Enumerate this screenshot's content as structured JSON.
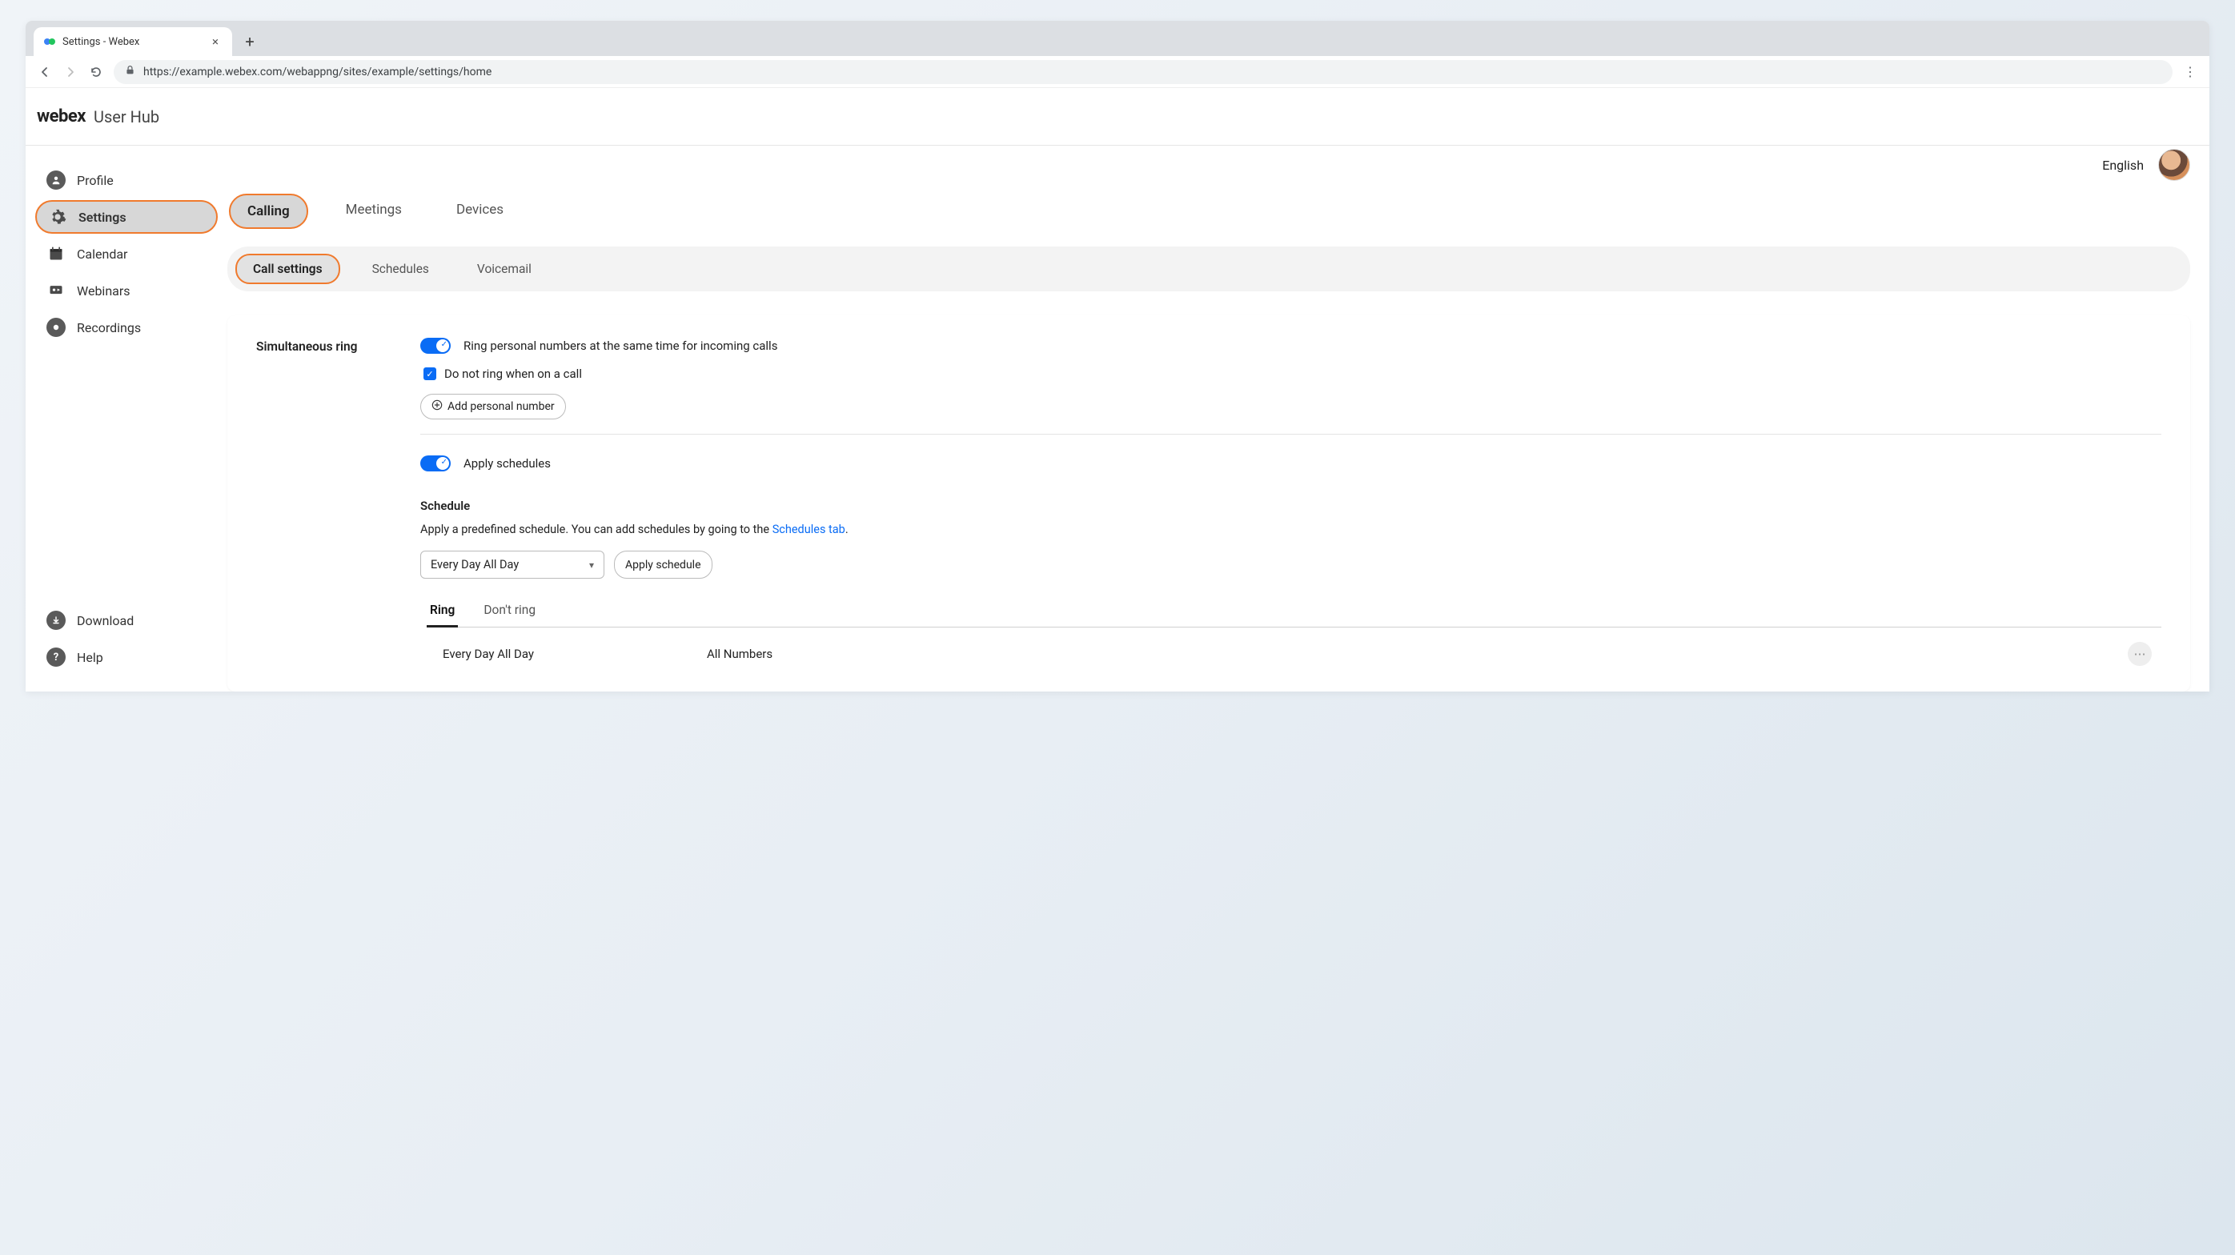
{
  "browser": {
    "tab_title": "Settings - Webex",
    "url": "https://example.webex.com/webappng/sites/example/settings/home"
  },
  "header": {
    "logo": "webex",
    "hub": "User Hub"
  },
  "topright": {
    "language": "English"
  },
  "sidebar": {
    "profile": "Profile",
    "settings": "Settings",
    "calendar": "Calendar",
    "webinars": "Webinars",
    "recordings": "Recordings",
    "download": "Download",
    "help": "Help"
  },
  "primary_tabs": {
    "calling": "Calling",
    "meetings": "Meetings",
    "devices": "Devices"
  },
  "sub_tabs": {
    "call_settings": "Call settings",
    "schedules": "Schedules",
    "voicemail": "Voicemail"
  },
  "simring": {
    "title": "Simultaneous ring",
    "toggle_label": "Ring personal numbers at the same time for incoming calls",
    "checkbox_label": "Do not ring when on a call",
    "add_number": "Add personal number"
  },
  "apply_schedules": {
    "toggle_label": "Apply schedules",
    "heading": "Schedule",
    "desc_prefix": "Apply a predefined schedule. You can add schedules by going to the ",
    "desc_link": "Schedules tab",
    "desc_suffix": ".",
    "select_value": "Every Day All Day",
    "apply_btn": "Apply schedule"
  },
  "ring_tabs": {
    "ring": "Ring",
    "dont_ring": "Don't ring"
  },
  "schedule_row": {
    "name": "Every Day All Day",
    "numbers": "All Numbers"
  }
}
